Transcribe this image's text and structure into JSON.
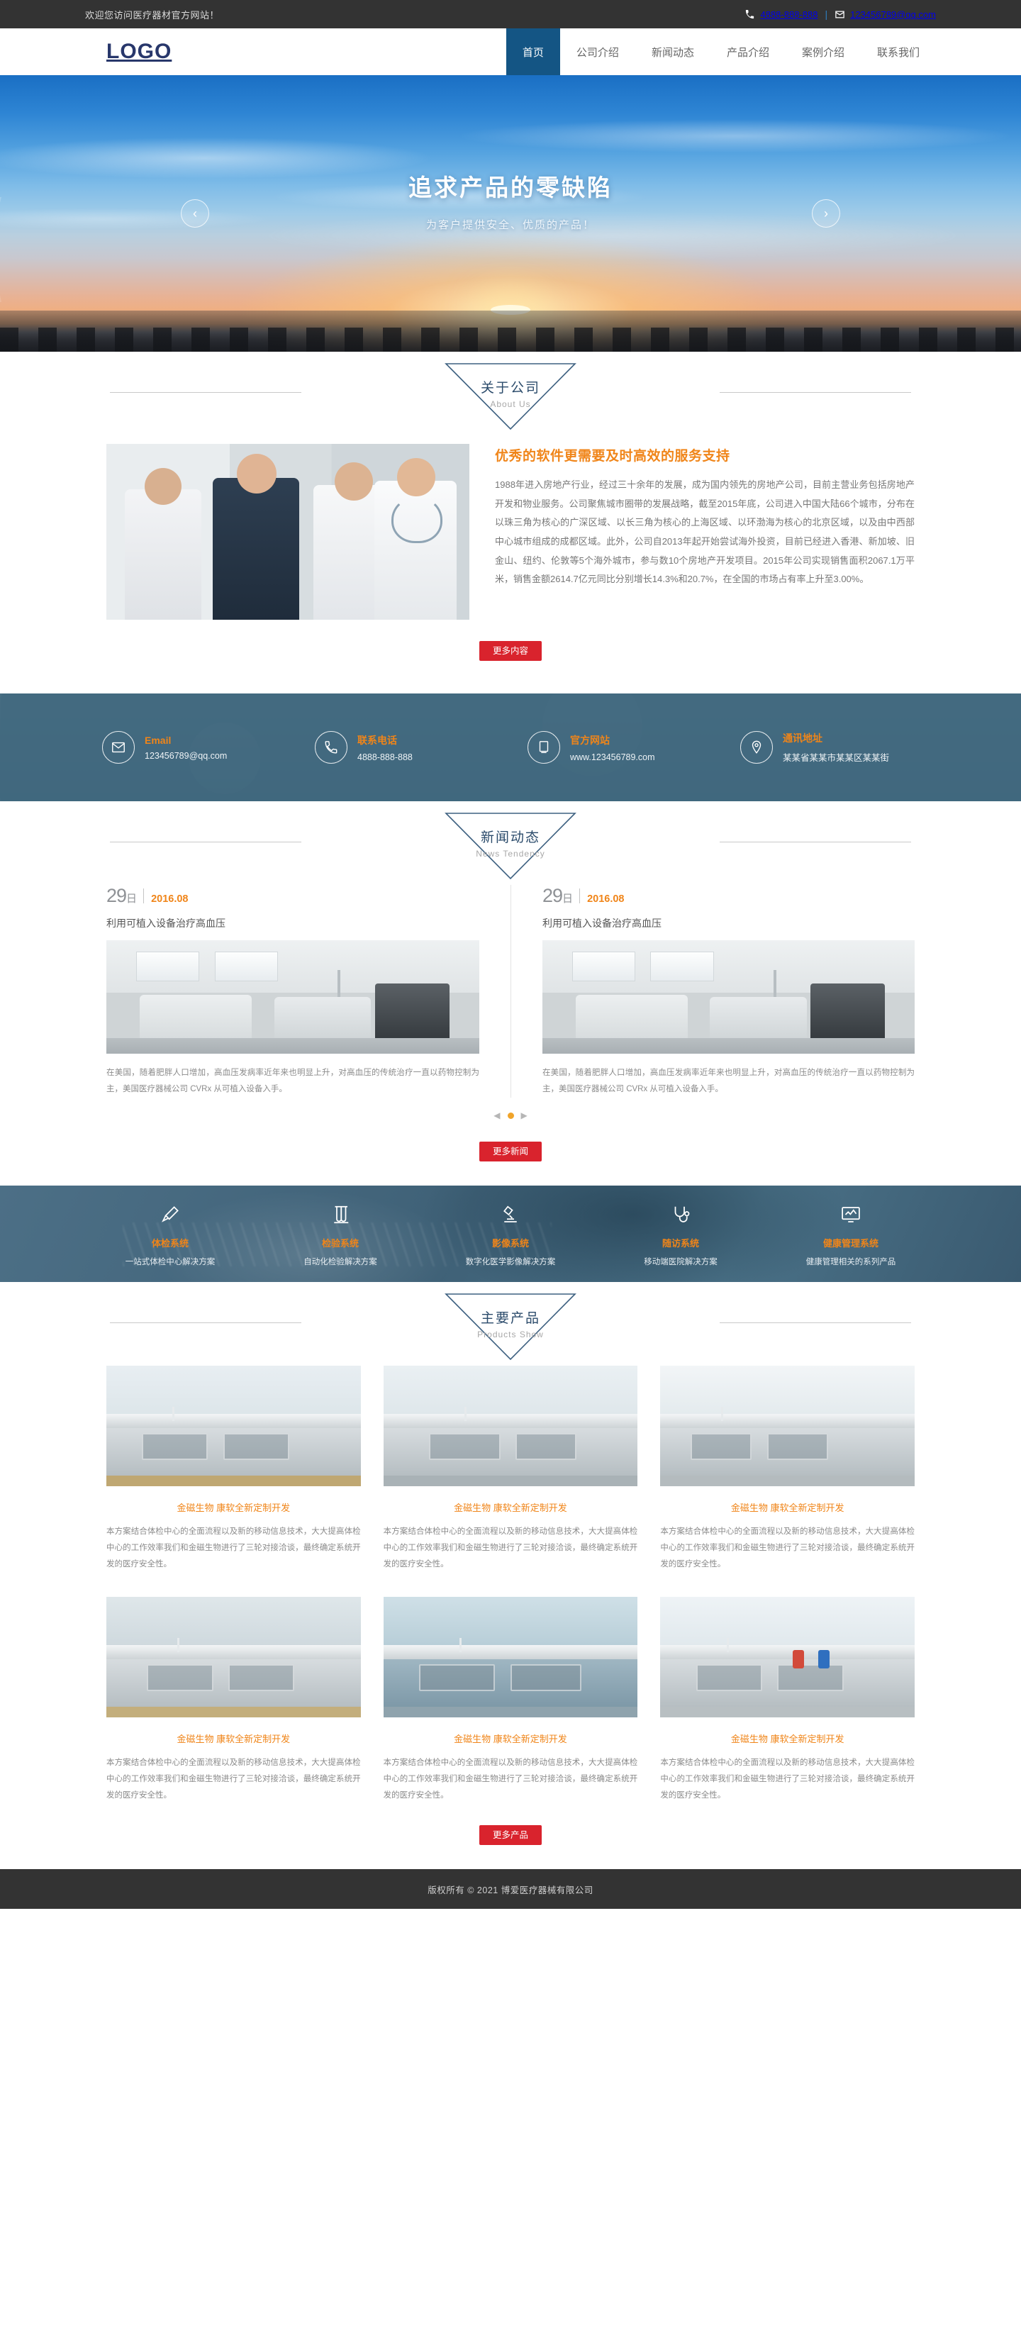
{
  "topbar": {
    "welcome": "欢迎您访问医疗器材官方网站！",
    "phone": "4888-888-888",
    "separator": "|",
    "email": "123456789@qq.com",
    "phone_icon": "phone-icon",
    "email_icon": "envelope-icon"
  },
  "header": {
    "logo": "LOGO",
    "nav": [
      {
        "label": "首页",
        "active": true
      },
      {
        "label": "公司介绍",
        "active": false
      },
      {
        "label": "新闻动态",
        "active": false
      },
      {
        "label": "产品介绍",
        "active": false
      },
      {
        "label": "案例介绍",
        "active": false
      },
      {
        "label": "联系我们",
        "active": false
      }
    ]
  },
  "hero": {
    "title": "追求产品的零缺陷",
    "subtitle": "为客户提供安全、优质的产品！",
    "prev_glyph": "‹",
    "next_glyph": "›"
  },
  "about": {
    "heading_cn": "关于公司",
    "heading_en": "About Us",
    "title": "优秀的软件更需要及时高效的服务支持",
    "body": "1988年进入房地产行业，经过三十余年的发展，成为国内领先的房地产公司，目前主营业务包括房地产开发和物业服务。公司聚焦城市圈带的发展战略，截至2015年底，公司进入中国大陆66个城市，分布在以珠三角为核心的广深区域、以长三角为核心的上海区域、以环渤海为核心的北京区域，以及由中西部中心城市组成的成都区域。此外，公司自2013年起开始尝试海外投资，目前已经进入香港、新加坡、旧金山、纽约、伦敦等5个海外城市，参与数10个房地产开发项目。2015年公司实现销售面积2067.1万平米，销售金额2614.7亿元同比分别增长14.3%和20.7%，在全国的市场占有率上升至3.00%。",
    "more_label": "更多内容"
  },
  "contact": [
    {
      "label": "Email",
      "value": "123456789@qq.com",
      "icon": "envelope-icon"
    },
    {
      "label": "联系电话",
      "value": "4888-888-888",
      "icon": "phone-icon"
    },
    {
      "label": "官方网站",
      "value": "www.123456789.com",
      "icon": "monitor-icon"
    },
    {
      "label": "通讯地址",
      "value": "某某省某某市某某区某某街",
      "icon": "map-pin-icon"
    }
  ],
  "news": {
    "heading_cn": "新闻动态",
    "heading_en": "News Tendency",
    "items": [
      {
        "day": "29",
        "day_unit": "日",
        "ym": "2016.08",
        "title": "利用可植入设备治疗高血压",
        "desc": "在美国，随着肥胖人口增加，高血压发病率近年来也明显上升，对高血压的传统治疗一直以药物控制为主，美国医疗器械公司 CVRx 从可植入设备入手。"
      },
      {
        "day": "29",
        "day_unit": "日",
        "ym": "2016.08",
        "title": "利用可植入设备治疗高血压",
        "desc": "在美国，随着肥胖人口增加，高血压发病率近年来也明显上升，对高血压的传统治疗一直以药物控制为主，美国医疗器械公司 CVRx 从可植入设备入手。"
      }
    ],
    "prev_glyph": "◀",
    "next_glyph": "▶",
    "more_label": "更多新闻"
  },
  "systems": [
    {
      "name": "体检系统",
      "desc": "一站式体检中心解决方案",
      "icon": "dropper-icon"
    },
    {
      "name": "检验系统",
      "desc": "自动化检验解决方案",
      "icon": "test-tube-icon"
    },
    {
      "name": "影像系统",
      "desc": "数字化医学影像解决方案",
      "icon": "microscope-icon"
    },
    {
      "name": "随访系统",
      "desc": "移动端医院解决方案",
      "icon": "stethoscope-icon"
    },
    {
      "name": "健康管理系统",
      "desc": "健康管理相关的系列产品",
      "icon": "monitor-chart-icon"
    }
  ],
  "products": {
    "heading_cn": "主要产品",
    "heading_en": "Products Show",
    "items": [
      {
        "title": "金磁生物 康软全新定制开发",
        "desc": "本方案结合体检中心的全面流程以及新的移动信息技术，大大提高体检中心的工作效率我们和金磁生物进行了三轮对接洽谈，最终确定系统开发的医疗安全性。"
      },
      {
        "title": "金磁生物 康软全新定制开发",
        "desc": "本方案结合体检中心的全面流程以及新的移动信息技术，大大提高体检中心的工作效率我们和金磁生物进行了三轮对接洽谈，最终确定系统开发的医疗安全性。"
      },
      {
        "title": "金磁生物 康软全新定制开发",
        "desc": "本方案结合体检中心的全面流程以及新的移动信息技术，大大提高体检中心的工作效率我们和金磁生物进行了三轮对接洽谈，最终确定系统开发的医疗安全性。"
      },
      {
        "title": "金磁生物 康软全新定制开发",
        "desc": "本方案结合体检中心的全面流程以及新的移动信息技术，大大提高体检中心的工作效率我们和金磁生物进行了三轮对接洽谈，最终确定系统开发的医疗安全性。"
      },
      {
        "title": "金磁生物 康软全新定制开发",
        "desc": "本方案结合体检中心的全面流程以及新的移动信息技术，大大提高体检中心的工作效率我们和金磁生物进行了三轮对接洽谈，最终确定系统开发的医疗安全性。"
      },
      {
        "title": "金磁生物 康软全新定制开发",
        "desc": "本方案结合体检中心的全面流程以及新的移动信息技术，大大提高体检中心的工作效率我们和金磁生物进行了三轮对接洽谈，最终确定系统开发的医疗安全性。"
      }
    ],
    "more_label": "更多产品"
  },
  "footer": {
    "copyright": "版权所有 © 2021 博爱医疗器械有限公司"
  },
  "colors": {
    "accent_orange": "#f08519",
    "brand_navy": "#28376b",
    "nav_active": "#145584",
    "button_red": "#d9232d",
    "dark_bar": "#333333"
  }
}
